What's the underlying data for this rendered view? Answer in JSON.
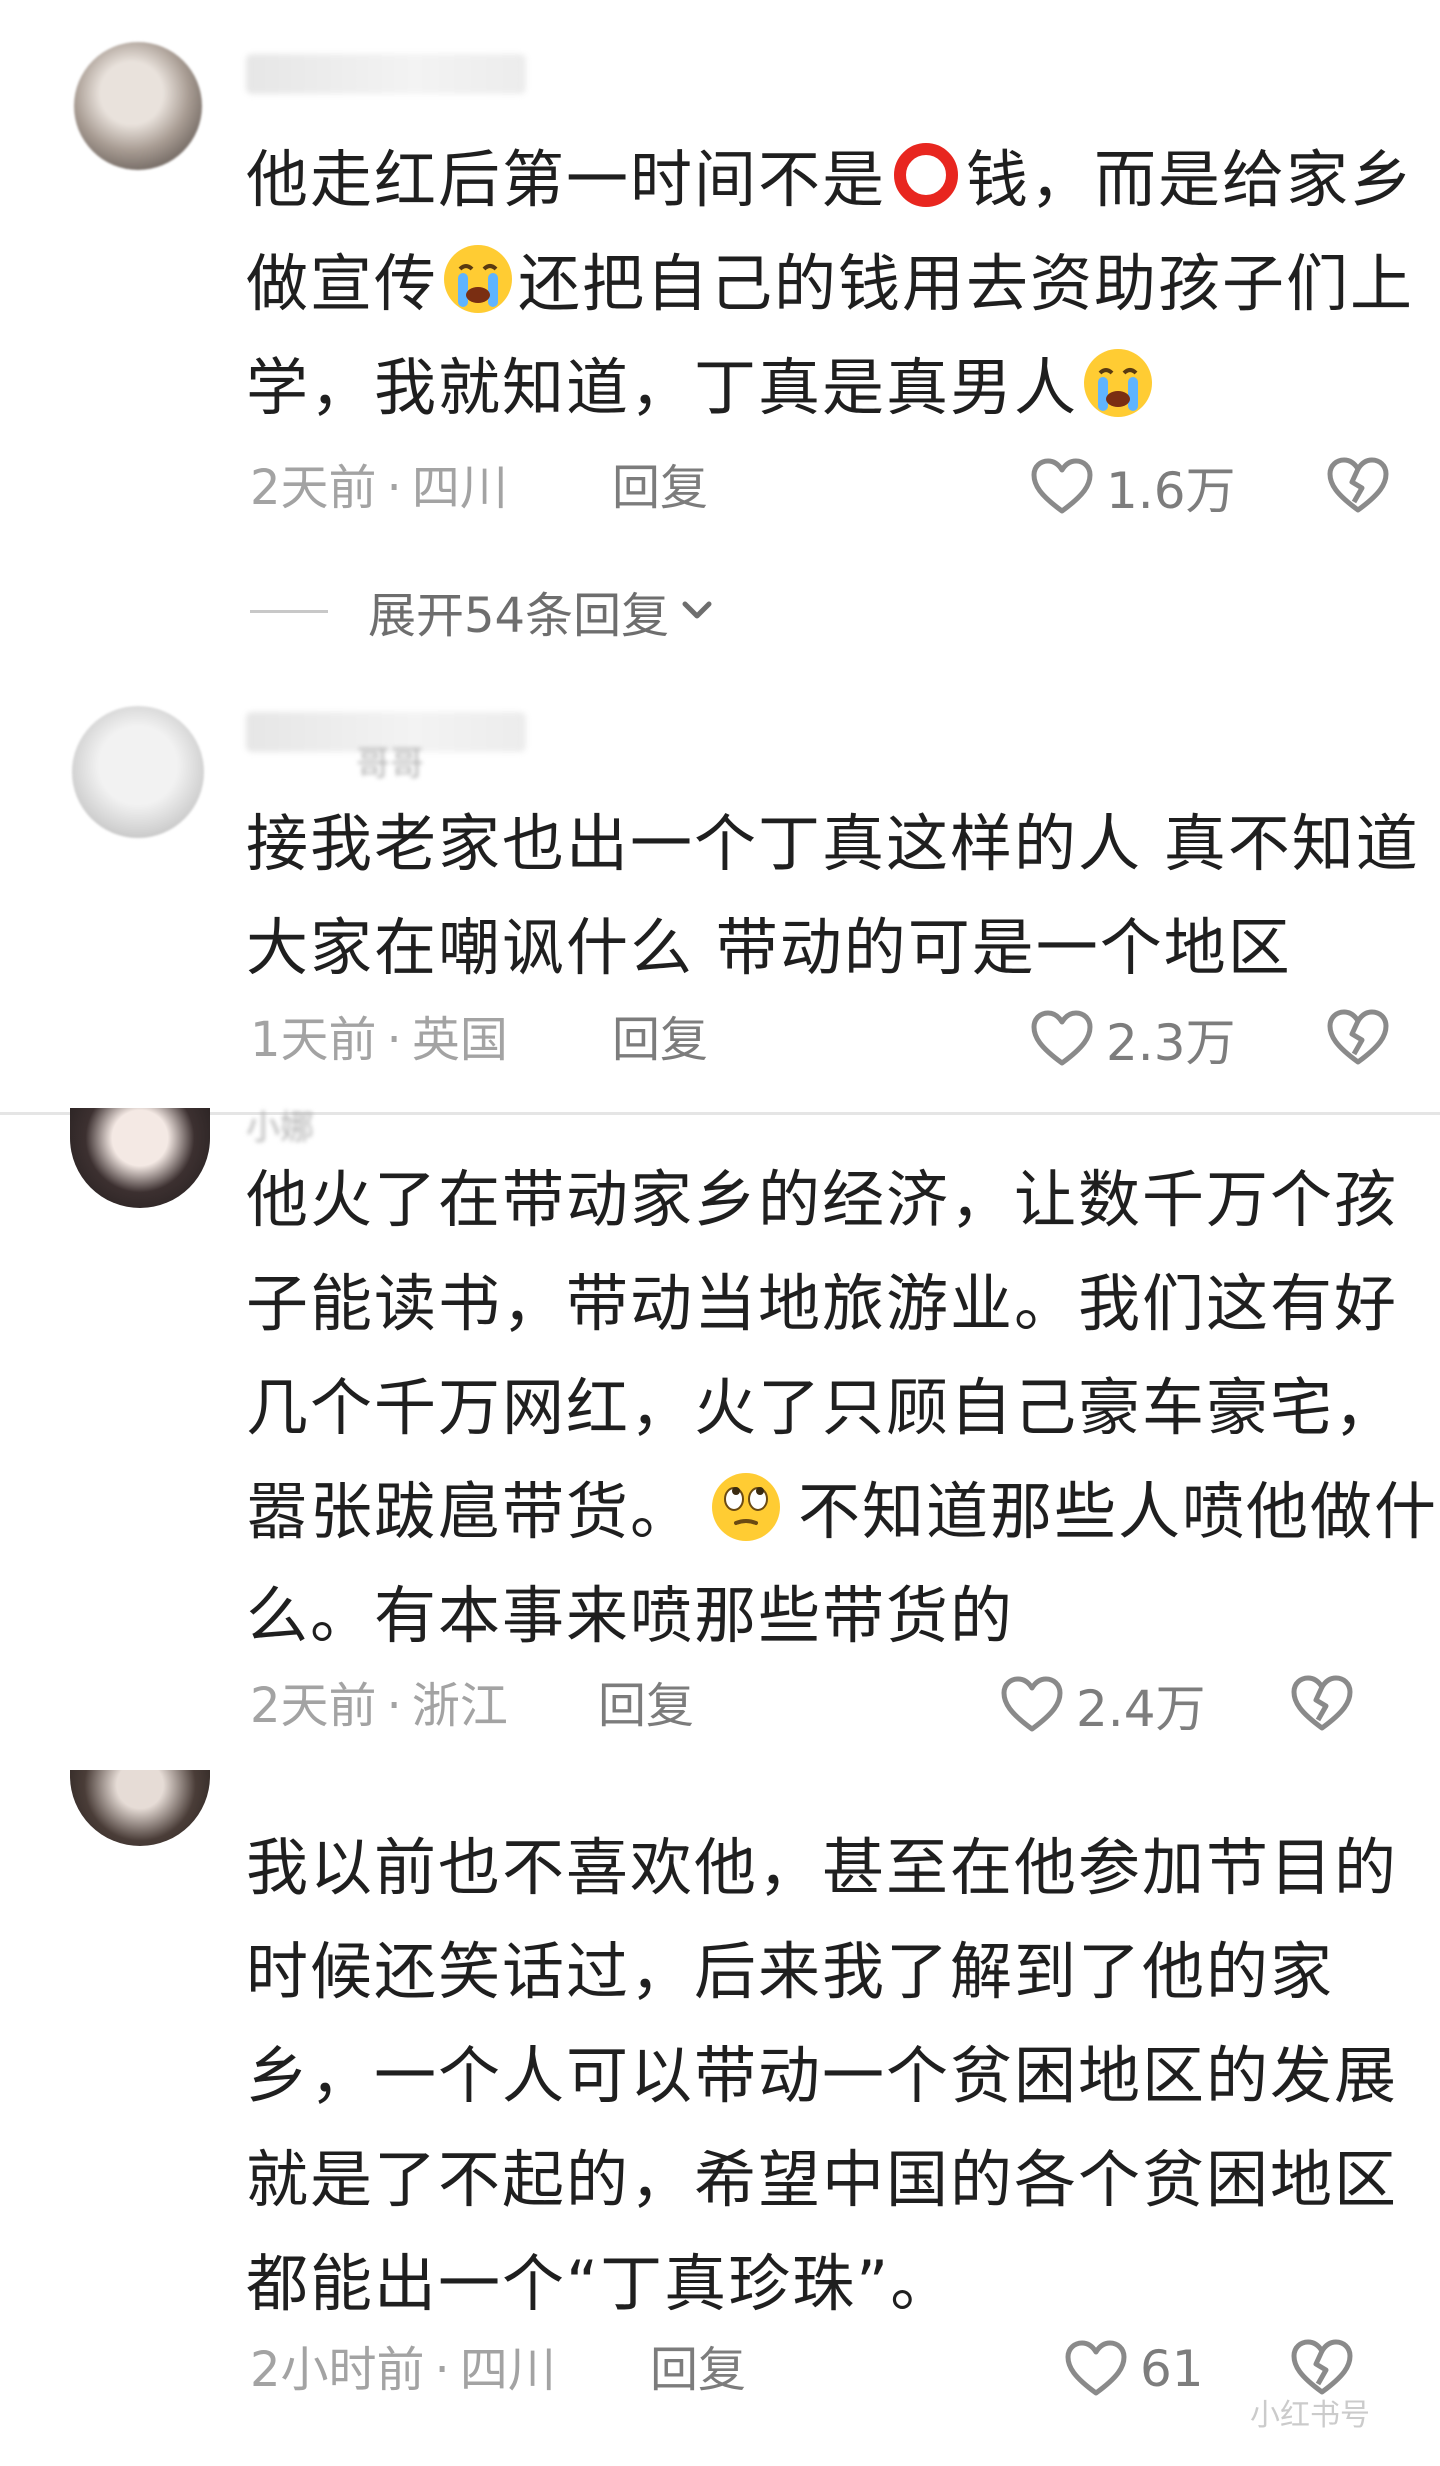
{
  "comments": [
    {
      "lines": [
        "他走红后第一时间不是",
        "钱，而是给家乡",
        "做宣传",
        "还把自己的钱用去资助孩子们上",
        "学，我就知道，丁真是真男人"
      ],
      "time": "2天前",
      "location": "四川",
      "reply": "回复",
      "likes": "1.6万",
      "expand": "展开54条回复"
    },
    {
      "username": "哥哥",
      "lines": [
        "接我老家也出一个丁真这样的人 真不知道",
        "大家在嘲讽什么 带动的可是一个地区"
      ],
      "time": "1天前",
      "location": "英国",
      "reply": "回复",
      "likes": "2.3万"
    },
    {
      "username": "小娜",
      "lines": [
        "他火了在带动家乡的经济，让数千万个孩",
        "子能读书，带动当地旅游业。我们这有好",
        "几个千万网红，火了只顾自己豪车豪宅，",
        "嚣张跋扈带货。",
        "不知道那些人喷他做什",
        "么。有本事来喷那些带货的"
      ],
      "time": "2天前",
      "location": "浙江",
      "reply": "回复",
      "likes": "2.4万"
    },
    {
      "lines": [
        "我以前也不喜欢他，甚至在他参加节目的",
        "时候还笑话过，后来我了解到了他的家",
        "乡，一个人可以带动一个贫困地区的发展",
        "就是了不起的，希望中国的各个贫困地区",
        "都能出一个“丁真珍珠”。"
      ],
      "time": "2小时前",
      "location": "四川",
      "reply": "回复",
      "likes": "61"
    }
  ],
  "watermark": "小红书号",
  "icons": {
    "circle": "red-circle-emoji",
    "cry": "crying-face-emoji",
    "eyeroll": "eye-roll-emoji",
    "like": "heart-outline-icon",
    "dislike": "broken-heart-icon",
    "expand": "chevron-down-icon"
  },
  "colors": {
    "text": "#1f1f1f",
    "meta": "#a3a3a3",
    "accent_red": "#e8261f"
  }
}
